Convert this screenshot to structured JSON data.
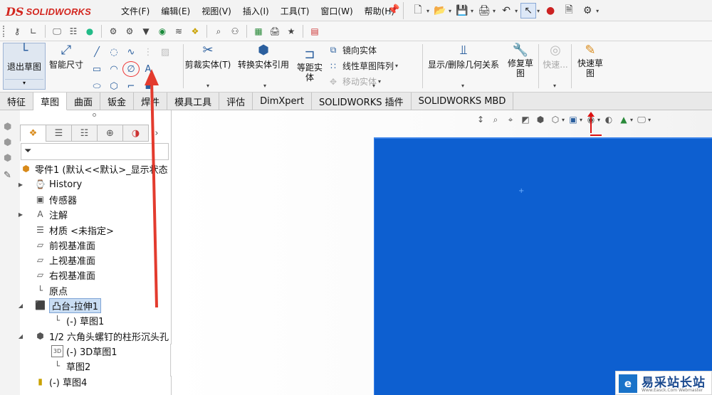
{
  "app": {
    "logo_prefix": "DS",
    "logo_name": "SOLIDWORKS"
  },
  "menu": {
    "items": [
      "文件(F)",
      "编辑(E)",
      "视图(V)",
      "插入(I)",
      "工具(T)",
      "窗口(W)",
      "帮助(H)"
    ]
  },
  "ribbon": {
    "exit_sketch": "退出草图",
    "smart_dim": "智能尺寸",
    "trim": "剪裁实体(T)",
    "convert": "转换实体引用",
    "offset_l1": "等距实",
    "offset_l2": "体",
    "mirror": "镜向实体",
    "linear_pattern": "线性草图阵列",
    "move": "移动实体",
    "relations": "显示/删除几何关系",
    "repair_l1": "修复草",
    "repair_l2": "图",
    "quick_snap": "快速...",
    "quick_sketch_l1": "快速草",
    "quick_sketch_l2": "图"
  },
  "tabs": [
    "特征",
    "草图",
    "曲面",
    "钣金",
    "焊件",
    "模具工具",
    "评估",
    "DimXpert",
    "SOLIDWORKS 插件",
    "SOLIDWORKS MBD"
  ],
  "tree": {
    "root": "零件1  (默认<<默认>_显示状态",
    "history": "History",
    "sensors": "传感器",
    "annotations": "注解",
    "material": "材质 <未指定>",
    "front_plane": "前视基准面",
    "top_plane": "上视基准面",
    "right_plane": "右视基准面",
    "origin": "原点",
    "boss_extrude": "凸台-拉伸1",
    "sketch1": "(-) 草图1",
    "hole": "1/2 六角头螺钉的柱形沉头孔",
    "sketch3d": "(-) 3D草图1",
    "sketch2": "草图2",
    "sketch4": "(-) 草图4"
  },
  "watermark": {
    "logo": "e",
    "title": "易采站长站",
    "subtitle": "Www.Easck.Com Webmaster"
  },
  "colors": {
    "brand": "#d3261f",
    "part_face": "#0d5fd0",
    "selection": "#c9ddf3",
    "annotation_arrow": "#e33b2e"
  }
}
